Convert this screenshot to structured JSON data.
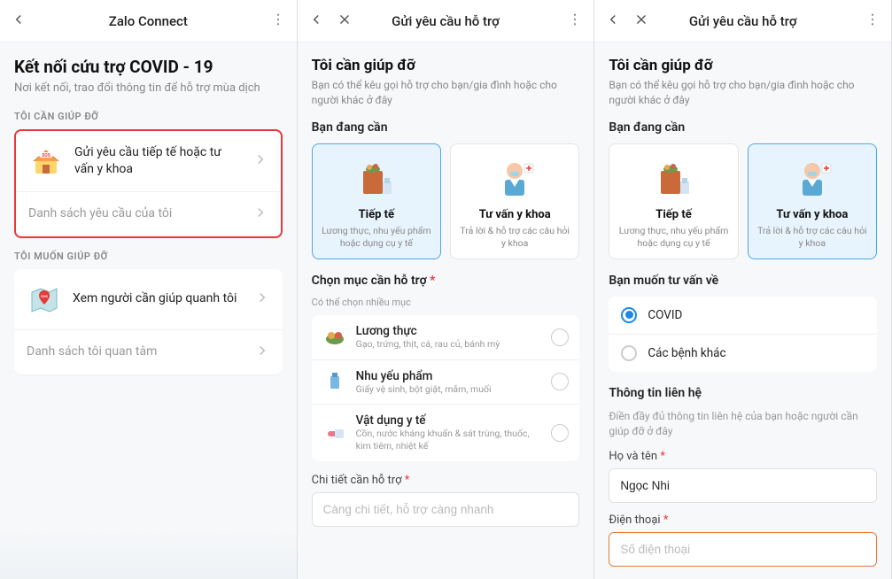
{
  "screen1": {
    "topbar": {
      "title": "Zalo Connect"
    },
    "heading": "Kết nối cứu trợ COVID - 19",
    "subtitle": "Nơi kết nối, trao đổi thông tin để hỗ trợ mùa dịch",
    "section1": {
      "label": "TÔI CẦN GIÚP ĐỠ",
      "row1": "Gửi yêu cầu tiếp tế hoặc tư vấn y khoa",
      "row2": "Danh sách yêu cầu của tôi"
    },
    "section2": {
      "label": "TÔI MUỐN GIÚP ĐỠ",
      "row1": "Xem người cần giúp quanh tôi",
      "row2": "Danh sách tôi quan tâm"
    }
  },
  "screen2": {
    "topbar": {
      "title": "Gửi yêu cầu hỗ trợ"
    },
    "heading": "Tôi cần giúp đỡ",
    "subtitle": "Bạn có thể kêu gọi hỗ trợ cho bạn/gia đình hoặc cho người khác ở đây",
    "need": {
      "label": "Bạn đang cần",
      "opt1": {
        "title": "Tiếp tế",
        "desc": "Lương thực, nhu yếu phẩm hoặc dụng cụ y tế"
      },
      "opt2": {
        "title": "Tư vấn y khoa",
        "desc": "Trả lời & hỗ trợ các câu hỏi y khoa"
      }
    },
    "select": {
      "label": "Chọn mục cần hỗ trợ",
      "sub": "Có thể chọn nhiều mục",
      "items": [
        {
          "title": "Lương thực",
          "desc": "Gạo, trứng, thịt, cá, rau củ, bánh mỳ"
        },
        {
          "title": "Nhu yếu phẩm",
          "desc": "Giấy vệ sinh, bột giặt, mắm, muối"
        },
        {
          "title": "Vật dụng y tế",
          "desc": "Cồn, nước kháng khuẩn & sát trùng, thuốc, kim tiêm, nhiệt kế"
        }
      ]
    },
    "detail": {
      "label": "Chi tiết cần hỗ trợ",
      "placeholder": "Càng chi tiết, hỗ trợ càng nhanh"
    }
  },
  "screen3": {
    "topbar": {
      "title": "Gửi yêu cầu hỗ trợ"
    },
    "heading": "Tôi cần giúp đỡ",
    "subtitle": "Bạn có thể kêu gọi hỗ trợ cho bạn/gia đình hoặc cho người khác ở đây",
    "need": {
      "label": "Bạn đang cần",
      "opt1": {
        "title": "Tiếp tế",
        "desc": "Lương thực, nhu yếu phẩm hoặc dụng cụ y tế"
      },
      "opt2": {
        "title": "Tư vấn y khoa",
        "desc": "Trả lời & hỗ trợ các câu hỏi y khoa"
      }
    },
    "consult": {
      "label": "Bạn muốn tư vấn về",
      "opt1": "COVID",
      "opt2": "Các bệnh khác"
    },
    "contact": {
      "label": "Thông tin liên hệ",
      "sub": "Điền đầy đủ thông tin liên hệ của bạn hoặc người cần giúp đỡ ở đây",
      "name_label": "Họ và tên",
      "name_value": "Ngọc Nhi",
      "phone_label": "Điện thoại",
      "phone_placeholder": "Số điện thoại"
    }
  }
}
